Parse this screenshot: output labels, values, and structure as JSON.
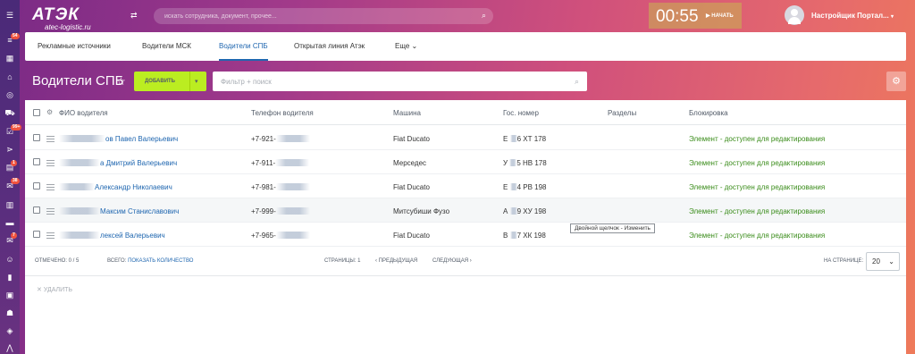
{
  "header": {
    "logo_text": "АТЭК",
    "logo_sub": "atec-logistic.ru",
    "search_placeholder": "искать сотрудника, документ, прочее...",
    "timer": "00:55",
    "start_label": "НАЧАТЬ",
    "user_name": "Настройщик Портал...",
    "accent": "#bbed21"
  },
  "rail": {
    "badges": [
      "54",
      "99+",
      "1",
      "38",
      "7"
    ]
  },
  "tabs": [
    {
      "label": "Рекламные источники"
    },
    {
      "label": "Водители МСК"
    },
    {
      "label": "Водители СПБ",
      "active": true
    },
    {
      "label": "Открытая линия Атэк"
    },
    {
      "label": "Еще"
    }
  ],
  "toolbar": {
    "title": "Водители СПБ",
    "add_label": "ДОБАВИТЬ",
    "filter_placeholder": "Фильтр + поиск"
  },
  "grid": {
    "columns": [
      "ФИО водителя",
      "Телефон водителя",
      "Машина",
      "Гос. номер",
      "Разделы",
      "Блокировка"
    ],
    "rows": [
      {
        "name": "ов Павел Валерьевич",
        "phone": "+7-921-",
        "car": "Fiat Ducato",
        "plate_a": "Е",
        "plate_b": "6 ХТ 178",
        "block": "Элемент - доступен для редактирования"
      },
      {
        "name": "а Дмитрий Валерьевич",
        "phone": "+7-911-",
        "car": "Мерседес",
        "plate_a": "У",
        "plate_b": "5 НВ 178",
        "block": "Элемент - доступен для редактирования"
      },
      {
        "name": "Александр Николаевич",
        "phone": "+7-981-",
        "car": "Fiat Ducato",
        "plate_a": "Е",
        "plate_b": "4 РВ 198",
        "block": "Элемент - доступен для редактирования"
      },
      {
        "name": "Максим Станиславович",
        "phone": "+7-999-",
        "car": "Митсубиши Фузо",
        "plate_a": "А",
        "plate_b": "9 ХУ 198",
        "block": "Элемент - доступен для редактирования"
      },
      {
        "name": "лексей Валерьевич",
        "phone": "+7-965-",
        "car": "Fiat Ducato",
        "plate_a": "В",
        "plate_b": "7 ХК 198",
        "block": "Элемент - доступен для редактирования"
      }
    ],
    "tooltip": "Двойной щелчок - Изменить"
  },
  "footer": {
    "selected": "ОТМЕЧЕНО: 0 / 5",
    "total_label": "ВСЕГО:",
    "total_link": "ПОКАЗАТЬ КОЛИЧЕСТВО",
    "pages": "СТРАНИЦЫ: 1",
    "prev": "ПРЕДЫДУЩАЯ",
    "next": "СЛЕДУЮЩАЯ",
    "per_page_label": "НА СТРАНИЦЕ:",
    "per_page": "20",
    "delete": "УДАЛИТЬ"
  }
}
